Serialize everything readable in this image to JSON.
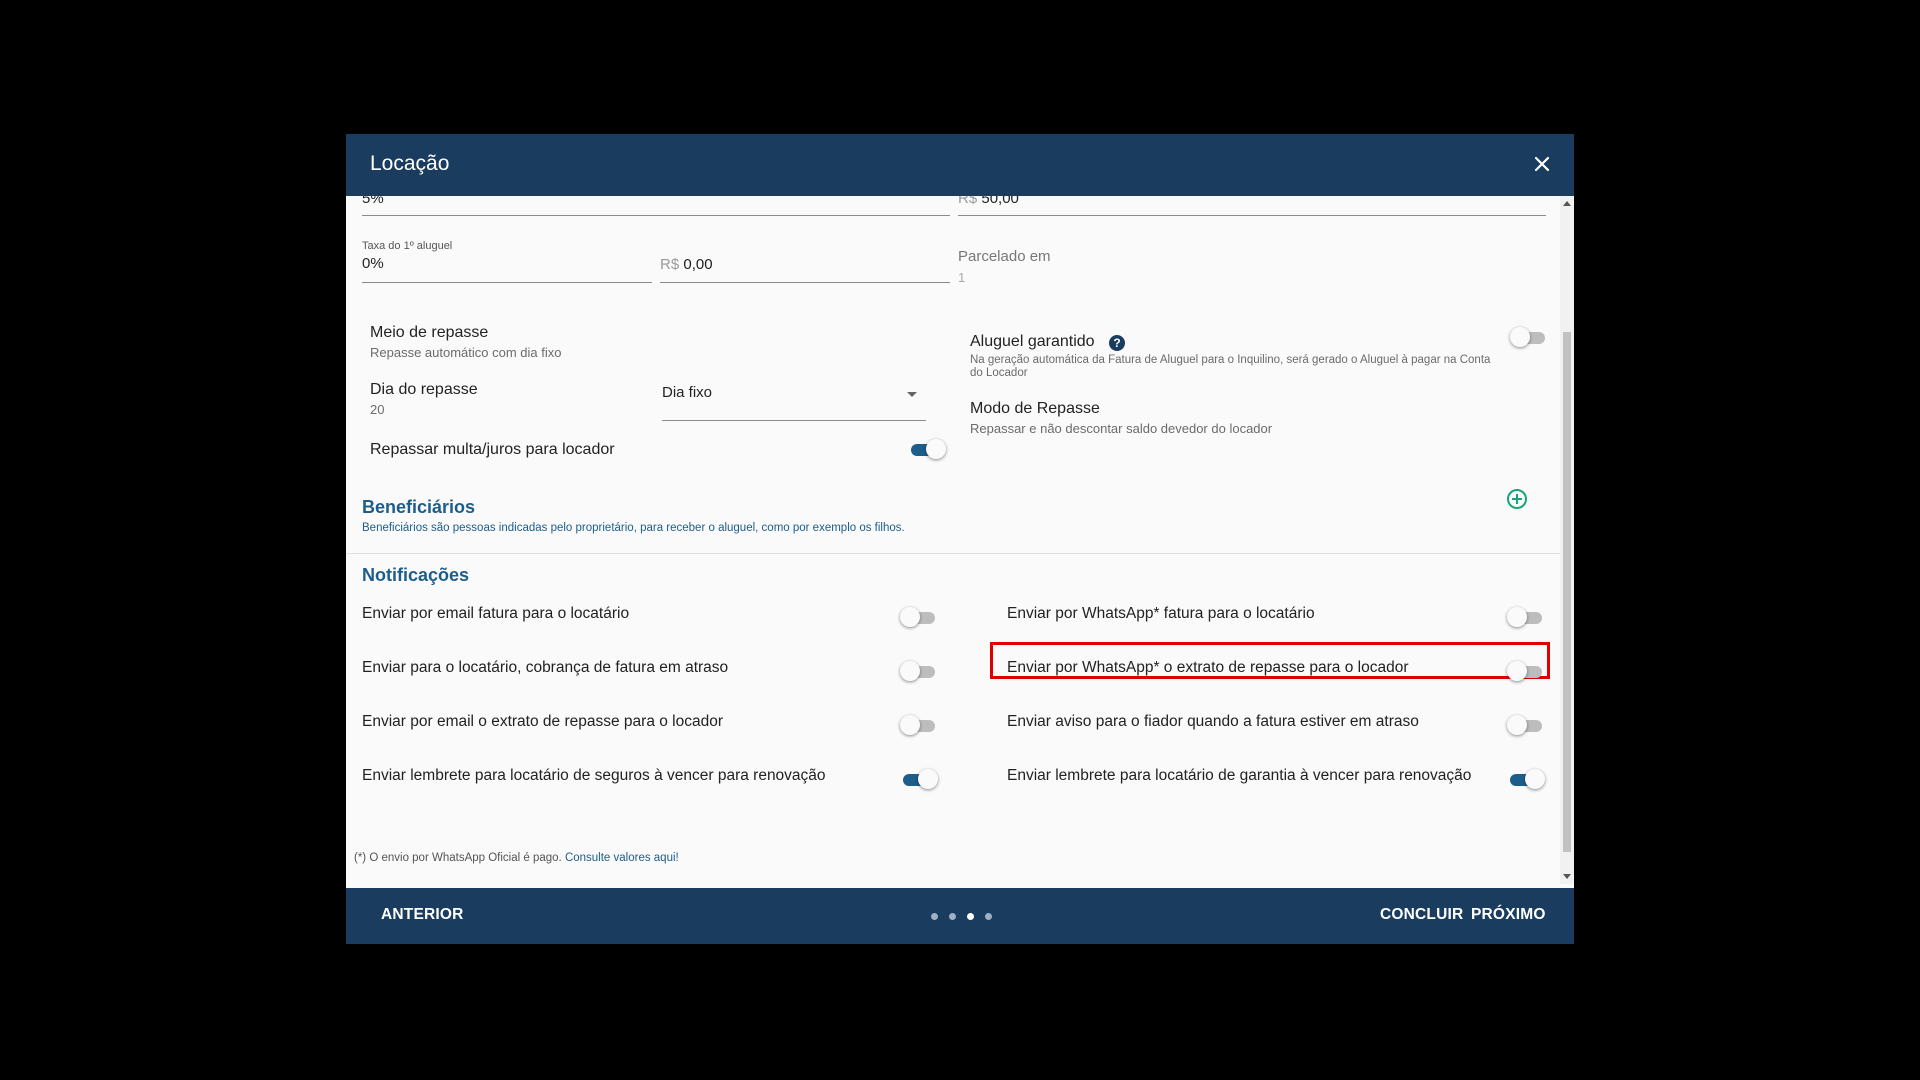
{
  "dialog": {
    "title": "Locação",
    "close_icon": "close-icon"
  },
  "top_partial": {
    "left_value": "5%",
    "right_prefix": "R$",
    "right_value": "50,00"
  },
  "taxa": {
    "label": "Taxa do 1º aluguel",
    "percent_value": "0%",
    "currency_prefix": "R$",
    "currency_value": "0,00",
    "parcelado_label": "Parcelado em",
    "parcelado_value": "1"
  },
  "repasse": {
    "meio_title": "Meio de repasse",
    "meio_sub": "Repasse automático com dia fixo",
    "dia_title": "Dia do repasse",
    "dia_value": "20",
    "dia_select": "Dia fixo",
    "multa_label": "Repassar multa/juros para locador",
    "multa_on": true,
    "garantido_title": "Aluguel garantido",
    "garantido_desc": "Na geração automática da Fatura de Aluguel para o Inquilino, será gerado o Aluguel à pagar na Conta do Locador",
    "garantido_on": false,
    "modo_title": "Modo de Repasse",
    "modo_sub": "Repassar e não descontar saldo devedor do locador"
  },
  "beneficiarios": {
    "title": "Beneficiários",
    "desc": "Beneficiários são pessoas indicadas pelo proprietário, para receber o aluguel, como por exemplo os filhos."
  },
  "notificacoes": {
    "title": "Notificações",
    "left": [
      {
        "label": "Enviar por email fatura para o locatário",
        "on": false
      },
      {
        "label": "Enviar para o locatário, cobrança de fatura em atraso",
        "on": false
      },
      {
        "label": "Enviar por email o extrato de repasse para o locador",
        "on": false
      },
      {
        "label": "Enviar lembrete para locatário de seguros à vencer para renovação",
        "on": true
      }
    ],
    "right": [
      {
        "label": "Enviar por WhatsApp* fatura para o locatário",
        "on": false
      },
      {
        "label": "Enviar por WhatsApp* o extrato de repasse para o locador",
        "on": false
      },
      {
        "label": "Enviar aviso para o fiador quando a fatura estiver em atraso",
        "on": false
      },
      {
        "label": "Enviar lembrete para locatário de garantia à vencer para renovação",
        "on": true
      }
    ],
    "footnote_text": "(*) O envio por WhatsApp Oficial é pago. ",
    "footnote_link": "Consulte valores aqui!"
  },
  "footer": {
    "anterior": "ANTERIOR",
    "concluir": "CONCLUIR",
    "proximo": "PRÓXIMO",
    "steps_total": 4,
    "active_step": 3
  },
  "colors": {
    "header_bg": "#1a3d5f",
    "accent": "#1d5d8c",
    "add_icon": "#1aa37a",
    "highlight": "#e00000"
  }
}
